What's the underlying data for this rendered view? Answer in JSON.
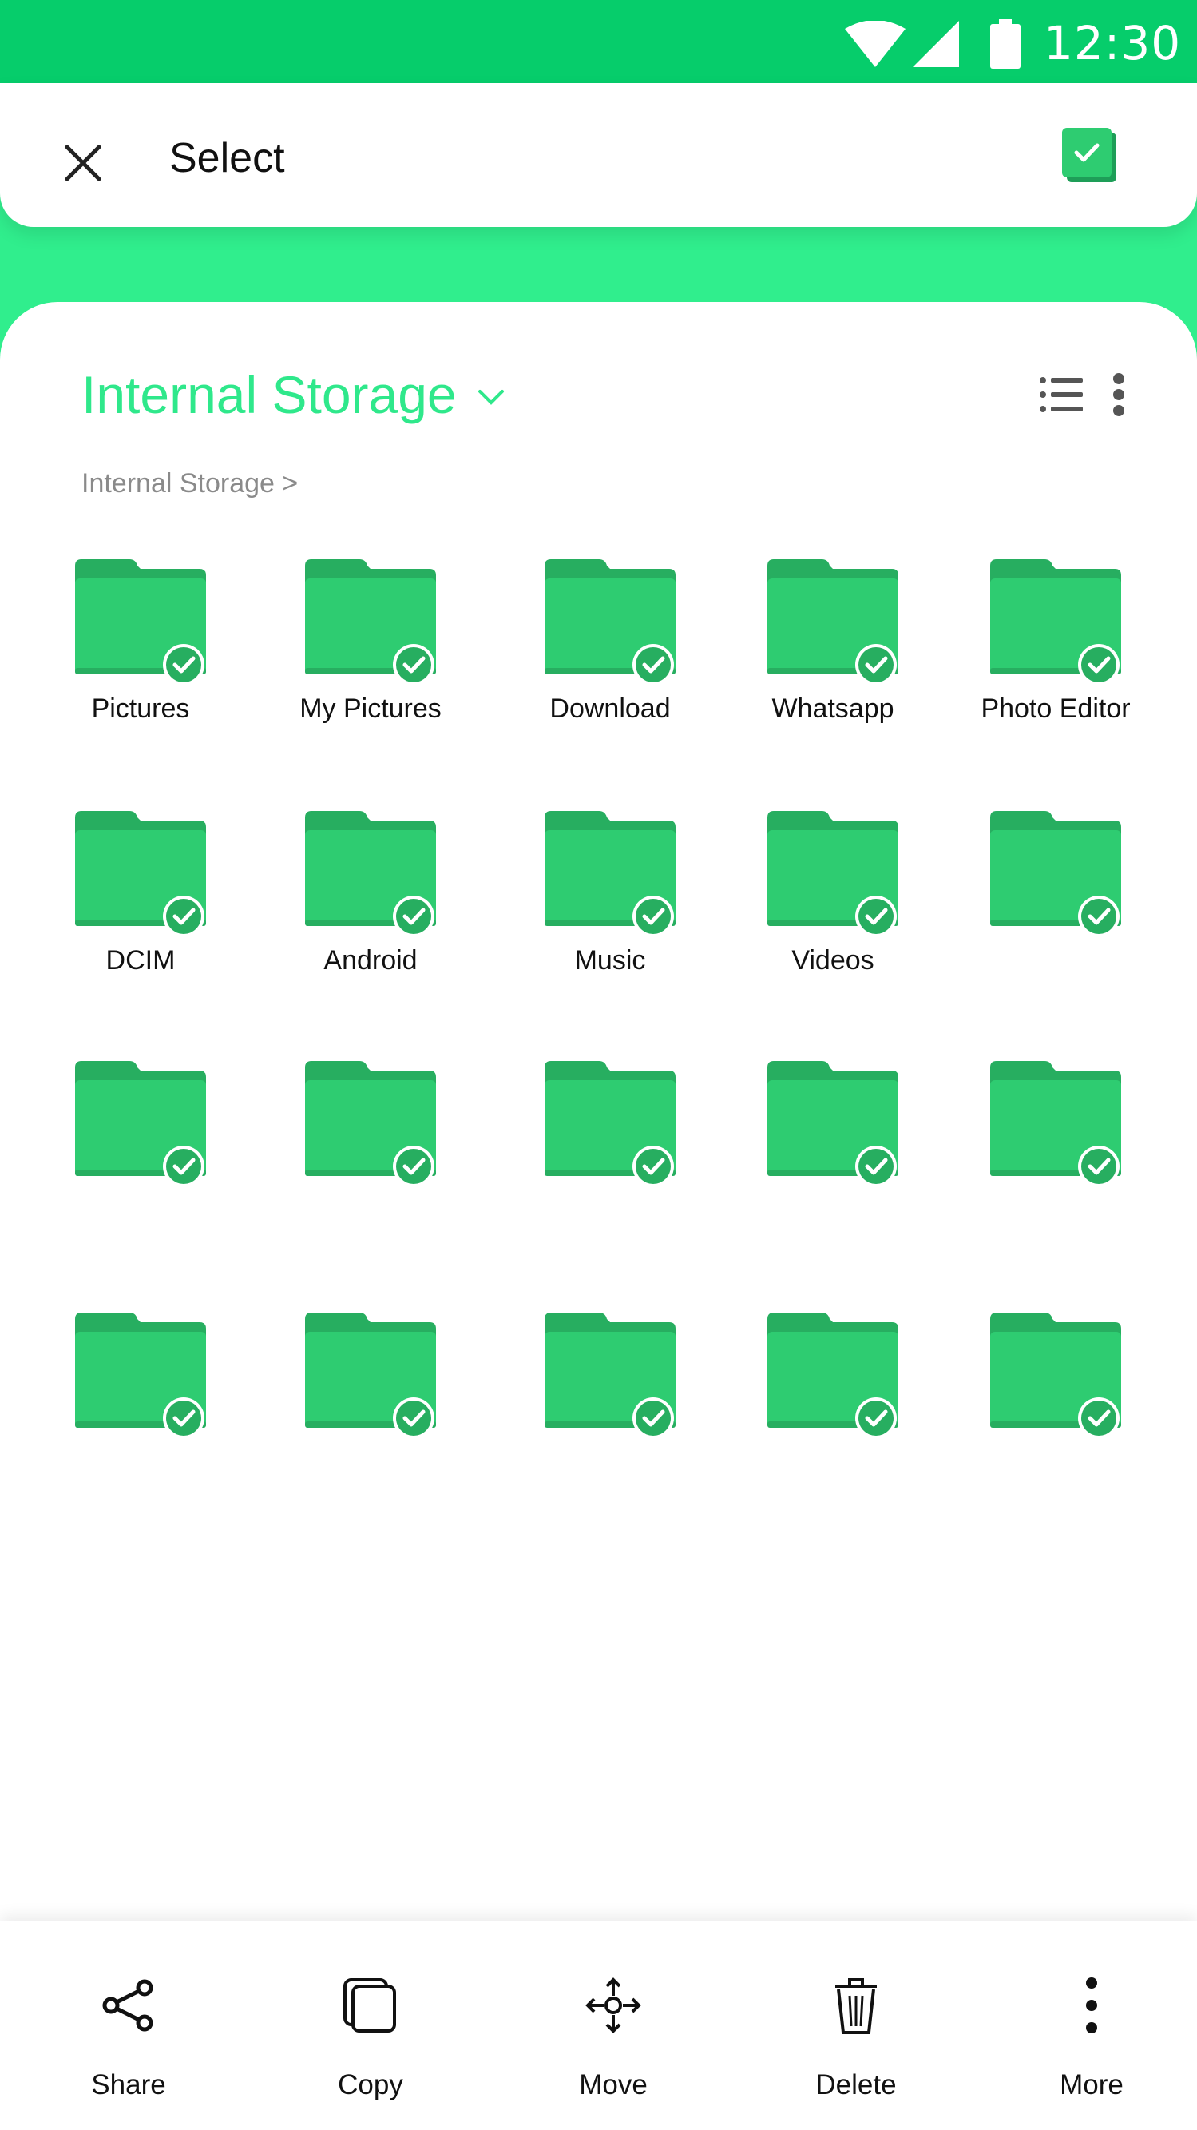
{
  "status_bar": {
    "time": "12:30",
    "icons": [
      "wifi-icon",
      "cellular-signal-icon",
      "battery-icon"
    ],
    "color": "#06cd6b"
  },
  "app_bar": {
    "title": "Select",
    "close_icon": "close-icon",
    "select_all_icon": "checkbox-checked-icon"
  },
  "storage": {
    "title": "Internal Storage",
    "breadcrumb": "Internal Storage >",
    "title_color": "#2fe88b",
    "view_icon": "list-view-icon",
    "menu_icon": "more-vert-icon"
  },
  "folders": [
    {
      "label": "Pictures",
      "selected": true
    },
    {
      "label": "My Pictures",
      "selected": true
    },
    {
      "label": "Download",
      "selected": true
    },
    {
      "label": "Whatsapp",
      "selected": true
    },
    {
      "label": "Photo Editor",
      "selected": true
    },
    {
      "label": "DCIM",
      "selected": true
    },
    {
      "label": "Android",
      "selected": true
    },
    {
      "label": "Music",
      "selected": true
    },
    {
      "label": "Videos",
      "selected": true
    },
    {
      "label": "",
      "selected": true
    },
    {
      "label": "",
      "selected": true
    },
    {
      "label": "",
      "selected": true
    },
    {
      "label": "",
      "selected": true
    },
    {
      "label": "",
      "selected": true
    },
    {
      "label": "",
      "selected": true
    },
    {
      "label": "",
      "selected": true
    },
    {
      "label": "",
      "selected": true
    },
    {
      "label": "",
      "selected": true
    },
    {
      "label": "",
      "selected": true
    },
    {
      "label": "",
      "selected": true
    }
  ],
  "colors": {
    "folder": "#2ecc71",
    "folder_tab": "#27ae60",
    "accent_band": "#30ee8d"
  },
  "bottom_actions": [
    {
      "label": "Share",
      "icon": "share-icon"
    },
    {
      "label": "Copy",
      "icon": "copy-icon"
    },
    {
      "label": "Move",
      "icon": "move-icon"
    },
    {
      "label": "Delete",
      "icon": "delete-icon"
    },
    {
      "label": "More",
      "icon": "more-vert-icon"
    }
  ]
}
